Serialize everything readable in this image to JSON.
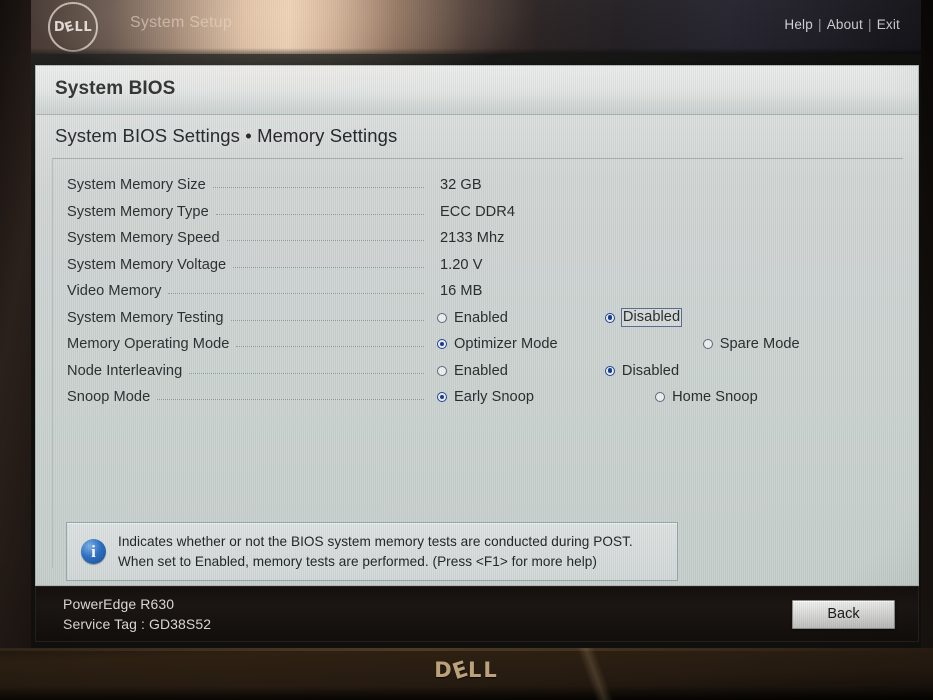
{
  "topbar": {
    "logo_text": "D∅LL",
    "app_title": "System Setup",
    "nav": {
      "help": "Help",
      "about": "About",
      "exit": "Exit",
      "separator": "|"
    }
  },
  "panel": {
    "title": "System BIOS",
    "breadcrumb": "System BIOS Settings • Memory Settings"
  },
  "settings": {
    "info_rows": [
      {
        "label": "System Memory Size",
        "value": "32 GB"
      },
      {
        "label": "System Memory Type",
        "value": "ECC DDR4"
      },
      {
        "label": "System Memory Speed",
        "value": "2133 Mhz"
      },
      {
        "label": "System Memory Voltage",
        "value": "1.20 V"
      },
      {
        "label": "Video Memory",
        "value": "16 MB"
      }
    ],
    "option_rows": [
      {
        "label": "System Memory Testing",
        "options": [
          {
            "text": "Enabled",
            "selected": false,
            "focused": false
          },
          {
            "text": "Disabled",
            "selected": true,
            "focused": true
          }
        ]
      },
      {
        "label": "Memory Operating Mode",
        "options": [
          {
            "text": "Optimizer Mode",
            "selected": true,
            "focused": false
          },
          {
            "text": "Spare Mode",
            "selected": false,
            "focused": false
          }
        ]
      },
      {
        "label": "Node Interleaving",
        "options": [
          {
            "text": "Enabled",
            "selected": false,
            "focused": false
          },
          {
            "text": "Disabled",
            "selected": true,
            "focused": false
          }
        ]
      },
      {
        "label": "Snoop Mode",
        "options": [
          {
            "text": "Early Snoop",
            "selected": true,
            "focused": false
          },
          {
            "text": "Home Snoop",
            "selected": false,
            "focused": false
          }
        ]
      }
    ]
  },
  "help": {
    "icon": "info-icon",
    "line1": "Indicates whether or not the BIOS system memory tests are conducted during POST.",
    "line2": "When set to Enabled, memory tests are performed. (Press <F1> for more help)"
  },
  "footer": {
    "system_model": "PowerEdge R630",
    "service_tag": "Service Tag : GD38S52",
    "back_label": "Back"
  },
  "bezel": {
    "brand": "D∅LL"
  },
  "colors": {
    "accent_blue": "#1b3f96",
    "info_blue": "#2f72c4",
    "panel_bg": "#ced5d3",
    "footer_bg": "#15100d",
    "focus_border": "#5c6f93"
  }
}
